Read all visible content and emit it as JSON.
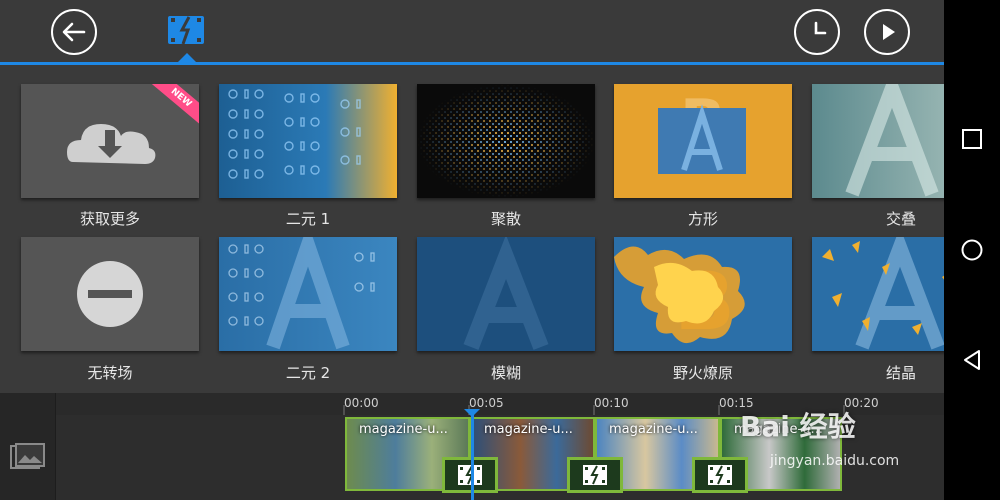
{
  "topbar": {
    "back_icon": "back-arrow-icon",
    "tab_icon": "transition-icon",
    "history_icon": "clock-icon",
    "play_icon": "play-icon"
  },
  "transitions": [
    {
      "label": "获取更多",
      "badge": "NEW",
      "icon": "cloud-download-icon"
    },
    {
      "label": "二元 1"
    },
    {
      "label": "聚散"
    },
    {
      "label": "方形"
    },
    {
      "label": "交叠"
    },
    {
      "label": "无转场",
      "icon": "no-entry-icon"
    },
    {
      "label": "二元 2"
    },
    {
      "label": "模糊"
    },
    {
      "label": "野火燎原"
    },
    {
      "label": "结晶"
    }
  ],
  "timeline": {
    "ticks": [
      "00:00",
      "00:05",
      "00:10",
      "00:15",
      "00:20"
    ],
    "clips": [
      {
        "title": "magazine-u..."
      },
      {
        "title": "magazine-u..."
      },
      {
        "title": "magazine-u..."
      },
      {
        "title": "magazine-u..."
      }
    ],
    "media_icon": "media-library-icon"
  },
  "watermark": {
    "text": "Bai 经验",
    "sub": "jingyan.baidu.com"
  },
  "colors": {
    "accent": "#1e88e5",
    "clip_border": "#7fb83b",
    "badge": "#ff4d88"
  }
}
